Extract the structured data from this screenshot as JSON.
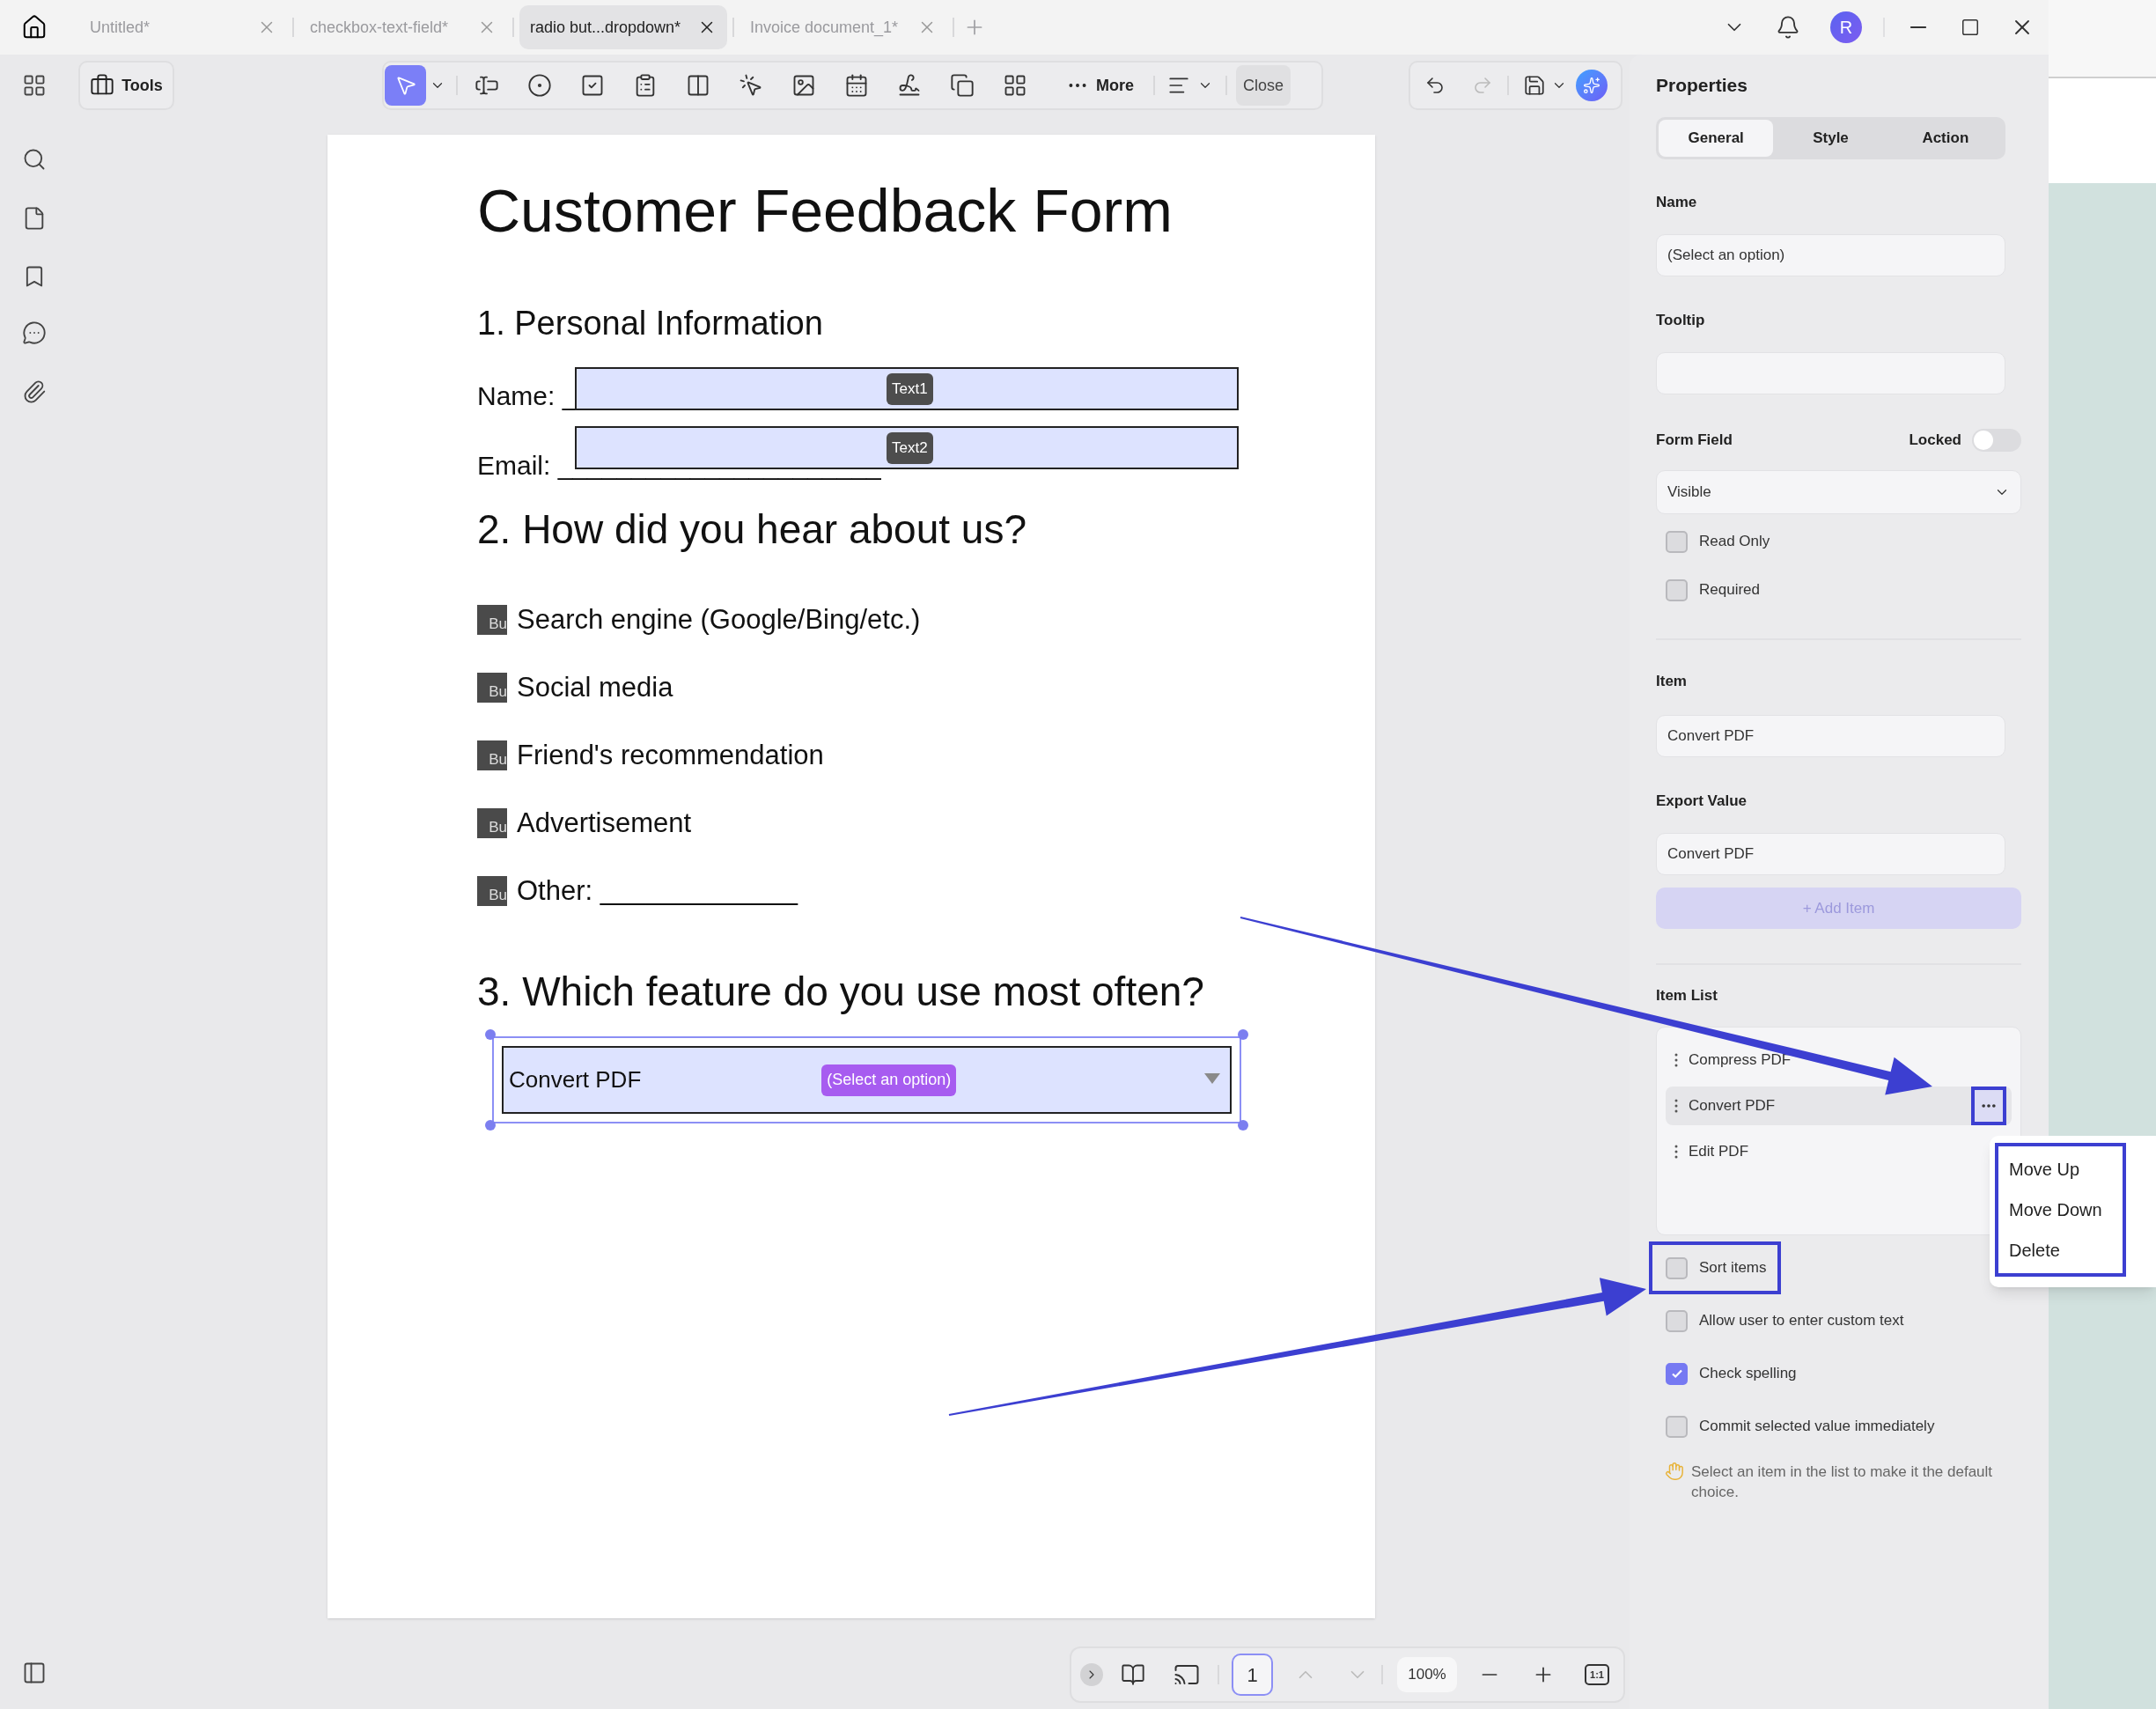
{
  "tabs": [
    {
      "label": "Untitled*",
      "selected": false
    },
    {
      "label": "checkbox-text-field*",
      "selected": false
    },
    {
      "label": "radio but...dropdown*",
      "selected": true
    },
    {
      "label": "Invoice document_1*",
      "selected": false
    }
  ],
  "avatar": "R",
  "toolbar": {
    "tools": "Tools",
    "more": "More",
    "close": "Close"
  },
  "document": {
    "title": "Customer Feedback Form",
    "section_1": "1. Personal Information",
    "fields": [
      {
        "label": "Name: _",
        "tag": "Text1"
      },
      {
        "label": "Email: ______________________",
        "tag": "Text2"
      }
    ],
    "section_2": "2. How did you hear about us?",
    "options": [
      {
        "badge": "Bu",
        "label": "Search engine (Google/Bing/etc.)"
      },
      {
        "badge": "Bu",
        "label": "Social media"
      },
      {
        "badge": "Bu",
        "label": "Friend's recommendation"
      },
      {
        "badge": "Bu",
        "label": "Advertisement"
      },
      {
        "badge": "Bu",
        "label": "Other: _____________"
      }
    ],
    "section_3": "3. Which feature do you use most often?",
    "dropdown": {
      "value": "Convert PDF",
      "tag": "(Select an option)"
    }
  },
  "properties": {
    "title": "Properties",
    "tabs": [
      {
        "label": "General",
        "selected": true
      },
      {
        "label": "Style",
        "selected": false
      },
      {
        "label": "Action",
        "selected": false
      }
    ],
    "name_label": "Name",
    "name_value": "(Select an option)",
    "tooltip_label": "Tooltip",
    "form_field_label": "Form Field",
    "locked_label": "Locked",
    "locked_on": false,
    "visibility": "Visible",
    "flags": [
      {
        "label": "Read Only",
        "checked": false
      },
      {
        "label": "Required",
        "checked": false
      }
    ],
    "item_label": "Item",
    "item_value": "Convert PDF",
    "export_label": "Export Value",
    "export_value": "Convert PDF",
    "add_item": "+ Add Item",
    "item_list_label": "Item List",
    "items": [
      {
        "label": "Compress PDF",
        "selected": false
      },
      {
        "label": "Convert PDF",
        "selected": true
      },
      {
        "label": "Edit PDF",
        "selected": false
      }
    ],
    "item_menu_highlighted": true,
    "menu": {
      "highlighted": true,
      "entries": [
        "Move Up",
        "Move Down",
        "Delete"
      ]
    },
    "options": [
      {
        "label": "Sort items",
        "checked": false,
        "highlighted": true
      },
      {
        "label": "Allow user to enter custom text",
        "checked": false,
        "highlighted": false
      },
      {
        "label": "Check spelling",
        "checked": true,
        "highlighted": false
      },
      {
        "label": "Commit selected value immediately",
        "checked": false,
        "highlighted": false
      }
    ],
    "hint": "Select an item in the list to make it the default choice."
  },
  "bottom_bar": {
    "page": "1",
    "zoom": "100%",
    "actual_size": "1:1"
  }
}
